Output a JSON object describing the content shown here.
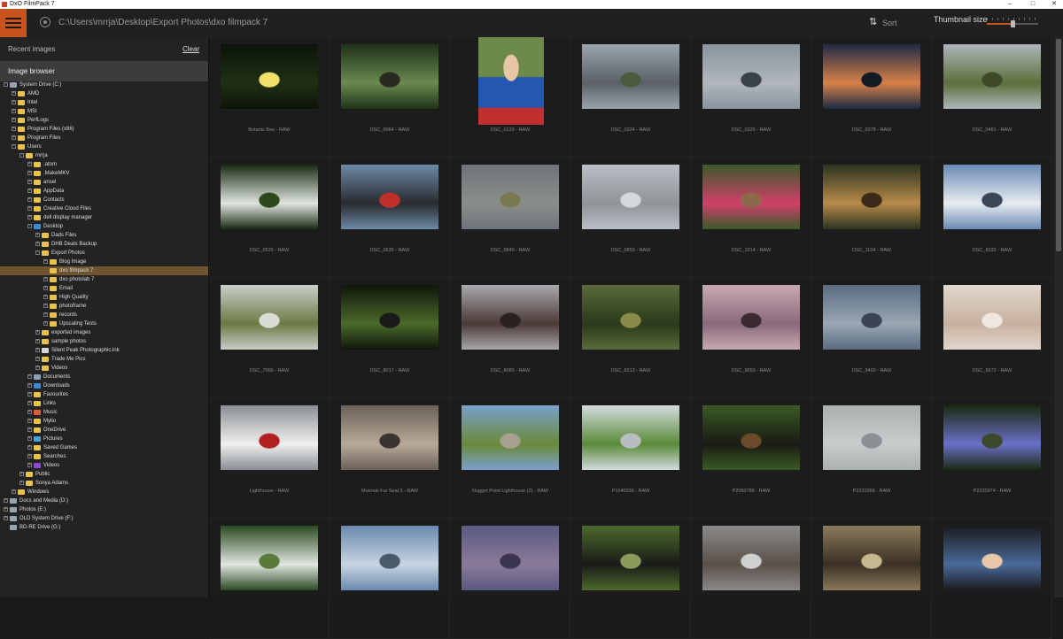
{
  "window": {
    "title": "DxO FilmPack 7",
    "controls": [
      "–",
      "□",
      "✕"
    ]
  },
  "toolbar": {
    "path": "C:\\Users\\mrrja\\Desktop\\Export Photos\\dxo filmpack 7",
    "sort_label": "Sort",
    "thumbnail_size_label": "Thumbnail size",
    "thumbnail_size_level": 0.5
  },
  "sidebar": {
    "recent_label": "Recent images",
    "clear_label": "Clear",
    "browser_label": "Image browser",
    "tree": [
      {
        "label": "System Drive (C:)",
        "depth": 0,
        "exp": "-",
        "icon": "drive-icon"
      },
      {
        "label": "AMD",
        "depth": 1,
        "exp": "+",
        "icon": "folder-icon"
      },
      {
        "label": "Intel",
        "depth": 1,
        "exp": "+",
        "icon": "folder-icon"
      },
      {
        "label": "MSI",
        "depth": 1,
        "exp": "+",
        "icon": "folder-icon"
      },
      {
        "label": "PerfLogs",
        "depth": 1,
        "exp": "+",
        "icon": "folder-icon"
      },
      {
        "label": "Program Files (x86)",
        "depth": 1,
        "exp": "+",
        "icon": "folder-icon"
      },
      {
        "label": "Program Files",
        "depth": 1,
        "exp": "+",
        "icon": "folder-icon"
      },
      {
        "label": "Users",
        "depth": 1,
        "exp": "-",
        "icon": "folder-icon"
      },
      {
        "label": "mrrja",
        "depth": 2,
        "exp": "-",
        "icon": "folder-icon"
      },
      {
        "label": ".atom",
        "depth": 3,
        "exp": "+",
        "icon": "folder-icon"
      },
      {
        "label": ".MakeMKV",
        "depth": 3,
        "exp": "+",
        "icon": "folder-icon"
      },
      {
        "label": "ansel",
        "depth": 3,
        "exp": "+",
        "icon": "folder-icon"
      },
      {
        "label": "AppData",
        "depth": 3,
        "exp": "+",
        "icon": "folder-icon"
      },
      {
        "label": "Contacts",
        "depth": 3,
        "exp": "+",
        "icon": "folder-icon"
      },
      {
        "label": "Creative Cloud Files",
        "depth": 3,
        "exp": "+",
        "icon": "folder-icon"
      },
      {
        "label": "dell display manager",
        "depth": 3,
        "exp": "+",
        "icon": "folder-icon"
      },
      {
        "label": "Desktop",
        "depth": 3,
        "exp": "-",
        "icon": "desktop-icon"
      },
      {
        "label": "Dads Files",
        "depth": 4,
        "exp": "+",
        "icon": "folder-icon"
      },
      {
        "label": "DHB Deals Backup",
        "depth": 4,
        "exp": "+",
        "icon": "folder-icon"
      },
      {
        "label": "Export Photos",
        "depth": 4,
        "exp": "-",
        "icon": "folder-icon"
      },
      {
        "label": "Blog Image",
        "depth": 5,
        "exp": "+",
        "icon": "folder-icon"
      },
      {
        "label": "dxo filmpack 7",
        "depth": 5,
        "exp": "",
        "icon": "folder-icon",
        "selected": true
      },
      {
        "label": "dxo photolab 7",
        "depth": 5,
        "exp": "+",
        "icon": "folder-icon"
      },
      {
        "label": "Email",
        "depth": 5,
        "exp": "+",
        "icon": "folder-icon"
      },
      {
        "label": "High Quality",
        "depth": 5,
        "exp": "+",
        "icon": "folder-icon"
      },
      {
        "label": "photoframe",
        "depth": 5,
        "exp": "+",
        "icon": "folder-icon"
      },
      {
        "label": "records",
        "depth": 5,
        "exp": "+",
        "icon": "folder-icon"
      },
      {
        "label": "Upscaling Tests",
        "depth": 5,
        "exp": "+",
        "icon": "folder-icon"
      },
      {
        "label": "exported images",
        "depth": 4,
        "exp": "+",
        "icon": "folder-icon"
      },
      {
        "label": "sample photos",
        "depth": 4,
        "exp": "+",
        "icon": "folder-icon"
      },
      {
        "label": "Silent Peak Photographic.lnk",
        "depth": 4,
        "exp": "+",
        "icon": "shortcut-icon"
      },
      {
        "label": "Trade Me Pics",
        "depth": 4,
        "exp": "+",
        "icon": "folder-icon"
      },
      {
        "label": "Videos",
        "depth": 4,
        "exp": "+",
        "icon": "folder-icon"
      },
      {
        "label": "Documents",
        "depth": 3,
        "exp": "+",
        "icon": "documents-icon"
      },
      {
        "label": "Downloads",
        "depth": 3,
        "exp": "+",
        "icon": "downloads-icon"
      },
      {
        "label": "Favourites",
        "depth": 3,
        "exp": "+",
        "icon": "folder-icon"
      },
      {
        "label": "Links",
        "depth": 3,
        "exp": "+",
        "icon": "folder-icon"
      },
      {
        "label": "Music",
        "depth": 3,
        "exp": "+",
        "icon": "music-icon"
      },
      {
        "label": "Mylio",
        "depth": 3,
        "exp": "+",
        "icon": "folder-icon"
      },
      {
        "label": "OneDrive",
        "depth": 3,
        "exp": "+",
        "icon": "folder-icon"
      },
      {
        "label": "Pictures",
        "depth": 3,
        "exp": "+",
        "icon": "pictures-icon"
      },
      {
        "label": "Saved Games",
        "depth": 3,
        "exp": "+",
        "icon": "folder-icon"
      },
      {
        "label": "Searches",
        "depth": 3,
        "exp": "+",
        "icon": "folder-icon"
      },
      {
        "label": "Videos",
        "depth": 3,
        "exp": "+",
        "icon": "videos-icon"
      },
      {
        "label": "Public",
        "depth": 2,
        "exp": "+",
        "icon": "folder-icon"
      },
      {
        "label": "Sonya Adams",
        "depth": 2,
        "exp": "+",
        "icon": "folder-icon"
      },
      {
        "label": "Windows",
        "depth": 1,
        "exp": "+",
        "icon": "folder-icon"
      },
      {
        "label": "Docs and Media (D:)",
        "depth": 0,
        "exp": "+",
        "icon": "drive-icon"
      },
      {
        "label": "Photos (E:)",
        "depth": 0,
        "exp": "+",
        "icon": "drive-icon"
      },
      {
        "label": "OLD System Drive (F:)",
        "depth": 0,
        "exp": "+",
        "icon": "drive-icon"
      },
      {
        "label": "BD-RE Drive (G:)",
        "depth": 0,
        "exp": "",
        "icon": "disc-drive-icon"
      }
    ]
  },
  "images": [
    {
      "caption": "Botanic Bee - RAW",
      "orient": "landscape",
      "colors": [
        "#0c1408",
        "#1f3015",
        "#f1e06a"
      ]
    },
    {
      "caption": "DSC_0064 - RAW",
      "orient": "landscape",
      "colors": [
        "#1e3218",
        "#6a8a4e",
        "#2a2a22"
      ]
    },
    {
      "caption": "DSC_0133 - RAW",
      "orient": "portrait",
      "colors": [
        "#6e8a4a",
        "#2457b0",
        "#e8c7a6"
      ]
    },
    {
      "caption": "DSC_0324 - RAW",
      "orient": "landscape",
      "colors": [
        "#9aa4ac",
        "#5a6066",
        "#4a5a3a"
      ]
    },
    {
      "caption": "DSC_0326 - RAW",
      "orient": "landscape",
      "colors": [
        "#8a949e",
        "#b0b6bc",
        "#3a4048"
      ]
    },
    {
      "caption": "DSC_0378 - RAW",
      "orient": "landscape",
      "colors": [
        "#1e2a44",
        "#d8824a",
        "#141a24"
      ]
    },
    {
      "caption": "DSC_0481 - RAW",
      "orient": "landscape",
      "colors": [
        "#aeb6bc",
        "#5c6e3a",
        "#3e4a28"
      ]
    },
    {
      "caption": "DSC_0525 - RAW",
      "orient": "landscape",
      "colors": [
        "#1a2a12",
        "#dfe6e0",
        "#2e4a1c"
      ]
    },
    {
      "caption": "DSC_0635 - RAW",
      "orient": "landscape",
      "colors": [
        "#6c8aa8",
        "#2a2a2e",
        "#c0302a"
      ]
    },
    {
      "caption": "DSC_0840 - RAW",
      "orient": "landscape",
      "colors": [
        "#6e747a",
        "#8a8e8a",
        "#7a7a52"
      ]
    },
    {
      "caption": "DSC_0853 - RAW",
      "orient": "landscape",
      "colors": [
        "#b8bec4",
        "#8e9498",
        "#d4d8da"
      ]
    },
    {
      "caption": "DSC_1014 - RAW",
      "orient": "landscape",
      "colors": [
        "#3a5a2a",
        "#d0406a",
        "#8a6a4a"
      ]
    },
    {
      "caption": "DSC_1104 - RAW",
      "orient": "landscape",
      "colors": [
        "#2a3420",
        "#b88a4a",
        "#3a2a1a"
      ]
    },
    {
      "caption": "DSC_6032 - RAW",
      "orient": "landscape",
      "colors": [
        "#6a8ab4",
        "#e8ecf0",
        "#3a4658"
      ]
    },
    {
      "caption": "DSC_7066 - RAW",
      "orient": "landscape",
      "colors": [
        "#c8cec8",
        "#6a7a44",
        "#dadad6"
      ]
    },
    {
      "caption": "DSC_8017 - RAW",
      "orient": "landscape",
      "colors": [
        "#10160c",
        "#4a6a2a",
        "#1a1a1a"
      ]
    },
    {
      "caption": "DSC_8080 - RAW",
      "orient": "landscape",
      "colors": [
        "#a8a8ac",
        "#4a3a36",
        "#2a2222"
      ]
    },
    {
      "caption": "DSC_8313 - RAW",
      "orient": "landscape",
      "colors": [
        "#5a6a3a",
        "#2a3a1a",
        "#8a8a4a"
      ]
    },
    {
      "caption": "DSC_9050 - RAW",
      "orient": "landscape",
      "colors": [
        "#c8a8b0",
        "#8a6a7a",
        "#3a2a30"
      ]
    },
    {
      "caption": "DSC_9400 - RAW",
      "orient": "landscape",
      "colors": [
        "#5a6a80",
        "#9aa8b4",
        "#3a4452"
      ]
    },
    {
      "caption": "DSC_9672 - RAW",
      "orient": "landscape",
      "colors": [
        "#e0d8cc",
        "#c8b0a0",
        "#f0e8e0"
      ]
    },
    {
      "caption": "Lighthouse - RAW",
      "orient": "landscape",
      "colors": [
        "#8a8e92",
        "#f0f0f0",
        "#b02020"
      ]
    },
    {
      "caption": "Moeraki Fur Seal 3 - RAW",
      "orient": "landscape",
      "colors": [
        "#6a6058",
        "#b8aa98",
        "#3a3430"
      ]
    },
    {
      "caption": "Nugget Point Lighthouse (2) - RAW",
      "orient": "landscape",
      "colors": [
        "#7aa0cc",
        "#6a8a3a",
        "#a8a090"
      ]
    },
    {
      "caption": "P1040336 - RAW",
      "orient": "landscape",
      "colors": [
        "#d4dadc",
        "#5a8a3a",
        "#b8bec0"
      ]
    },
    {
      "caption": "P2050786 - RAW",
      "orient": "landscape",
      "colors": [
        "#3a5a24",
        "#1a1a14",
        "#6a4a2a"
      ]
    },
    {
      "caption": "P2220968 - RAW",
      "orient": "landscape",
      "colors": [
        "#aab0b0",
        "#c8cccc",
        "#8a9094"
      ]
    },
    {
      "caption": "P2220974 - RAW",
      "orient": "landscape",
      "colors": [
        "#1a2a12",
        "#6a70c8",
        "#3a4a2a"
      ]
    },
    {
      "caption": "",
      "orient": "landscape",
      "colors": [
        "#2a4a22",
        "#e0e6e0",
        "#5a7a3a"
      ]
    },
    {
      "caption": "",
      "orient": "landscape",
      "colors": [
        "#6a8ab0",
        "#c8d4e0",
        "#4a5a6a"
      ]
    },
    {
      "caption": "",
      "orient": "landscape",
      "colors": [
        "#5a5a80",
        "#8a7a9a",
        "#3a3450"
      ]
    },
    {
      "caption": "",
      "orient": "landscape",
      "colors": [
        "#4a6a2a",
        "#1a1a18",
        "#8a9a5a"
      ]
    },
    {
      "caption": "",
      "orient": "landscape",
      "colors": [
        "#8a8a8a",
        "#5a5048",
        "#d0d0d0"
      ]
    },
    {
      "caption": "",
      "orient": "landscape",
      "colors": [
        "#8a7a5a",
        "#3a3024",
        "#c8b890"
      ]
    },
    {
      "caption": "",
      "orient": "landscape",
      "colors": [
        "#1a1a1e",
        "#4a6a9a",
        "#e8c8a8"
      ]
    }
  ]
}
